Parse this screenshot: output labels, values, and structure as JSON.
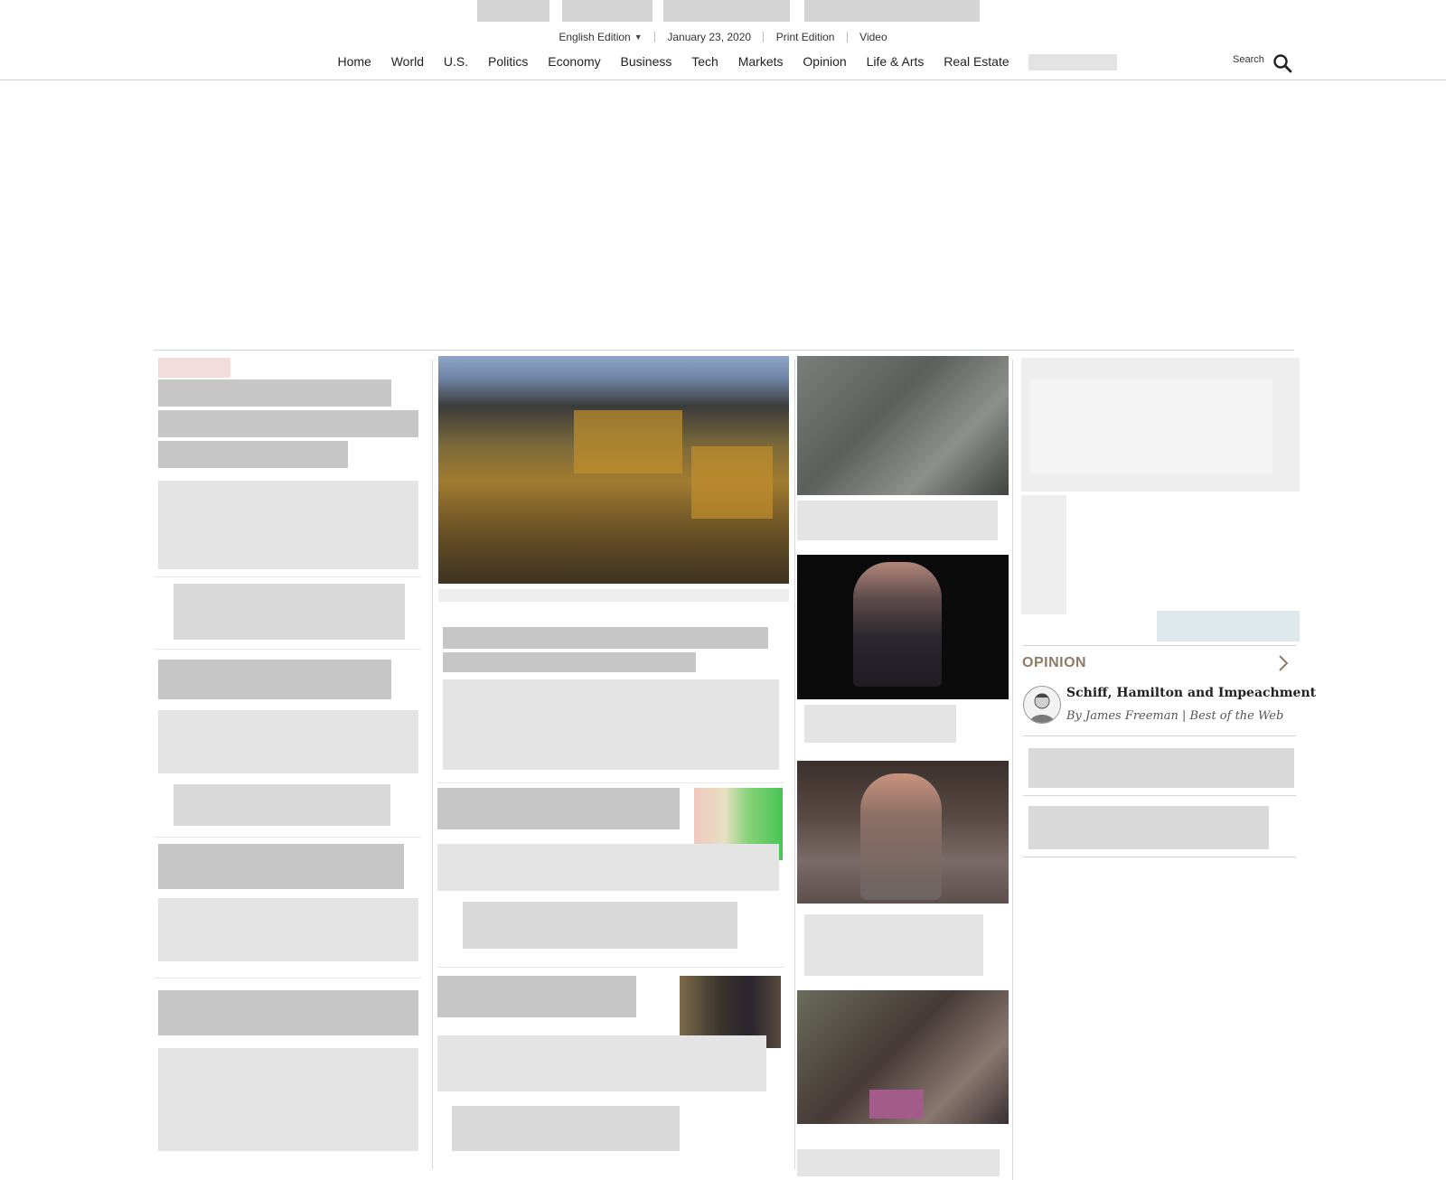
{
  "header": {
    "edition_label": "English Edition",
    "date": "January 23, 2020",
    "print_edition": "Print Edition",
    "video": "Video",
    "search_label": "Search"
  },
  "nav": {
    "items": [
      "Home",
      "World",
      "U.S.",
      "Politics",
      "Economy",
      "Business",
      "Tech",
      "Markets",
      "Opinion",
      "Life & Arts",
      "Real Estate"
    ]
  },
  "opinion": {
    "label": "OPINION",
    "headline": "Schiff, Hamilton and Impeachment",
    "byline": "By James Freeman | Best of the Web"
  },
  "icons": {
    "search": "search-icon",
    "caret": "caret-down-icon",
    "chevron": "chevron-right-icon",
    "avatar": "author-avatar"
  },
  "colors": {
    "opinion_accent": "#8f7a66",
    "text": "#222222",
    "rule": "#d4d4d4"
  }
}
